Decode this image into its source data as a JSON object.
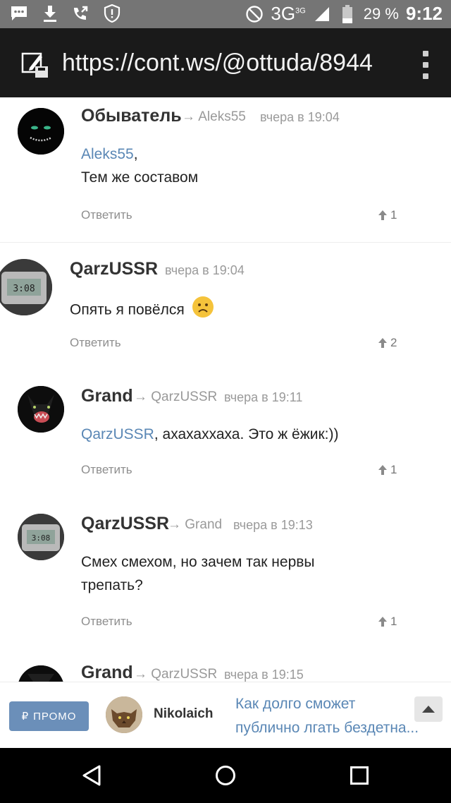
{
  "status_bar": {
    "network": "3G",
    "network_sup": "3G",
    "battery": "29 %",
    "time": "9:12",
    "left_icons": [
      "message-icon",
      "download-icon",
      "call-forward-icon",
      "shield-alert-icon"
    ],
    "right_icons": [
      "do-not-disturb-icon",
      "signal-icon",
      "battery-icon"
    ]
  },
  "browser": {
    "url": "https://cont.ws/@ottuda/8944",
    "icons": [
      "edit-page-icon",
      "menu-dots-icon"
    ]
  },
  "comments": [
    {
      "author": "Обыватель",
      "arrow": "→",
      "reply_to": "Aleks55",
      "time": "вчера в 19:04",
      "mention": "Aleks55",
      "text_after_mention": ",",
      "text_line2": "Тем же составом",
      "reply_label": "Ответить",
      "votes": "1"
    },
    {
      "author": "QarzUSSR",
      "time": "вчера в 19:04",
      "text": "Опять я повёлся",
      "emoji": "😟",
      "reply_label": "Ответить",
      "votes": "2"
    },
    {
      "author": "Grand",
      "arrow": "→",
      "reply_to": "QarzUSSR",
      "time": "вчера в 19:11",
      "mention": "QarzUSSR",
      "text_after_mention": ", ахахаххаха. Это ж ёжик:))",
      "reply_label": "Ответить",
      "votes": "1"
    },
    {
      "author": "QarzUSSR",
      "arrow": "→",
      "reply_to": "Grand",
      "time": "вчера в 19:13",
      "text_line1": "Смех смехом, но зачем так нервы",
      "text_line2": "трепать?",
      "reply_label": "Ответить",
      "votes": "1"
    },
    {
      "author": "Grand",
      "arrow": "→",
      "reply_to": "QarzUSSR",
      "time": "вчера в 19:15"
    }
  ],
  "promo": {
    "button_label": "ПРОМО",
    "currency_symbol": "₽",
    "user": "Nikolaich",
    "title_line1": "Как долго сможет",
    "title_line2": "публично лгать бездетна..."
  },
  "colors": {
    "accent": "#5a87b5",
    "promo_button": "#6b8fb9",
    "status_bar": "#757575",
    "url_bar": "#1a1a1a"
  }
}
